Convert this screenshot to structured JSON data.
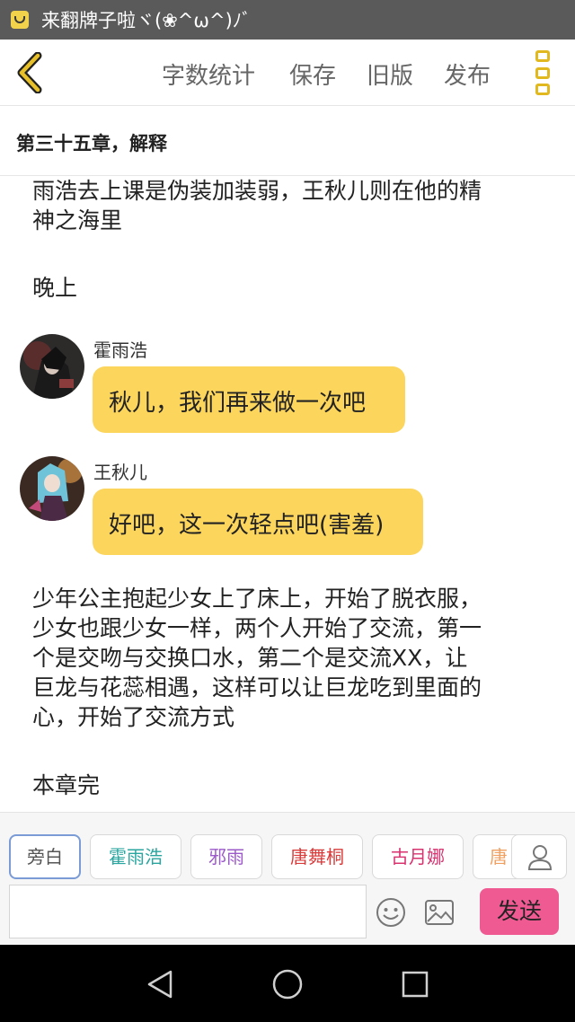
{
  "status_bar": {
    "title": "来翻牌子啦ヾ(❀^ω^)ﾉﾞ",
    "icon": "app-icon"
  },
  "toolbar": {
    "back_icon": "chevron-left-icon",
    "items": [
      "字数统计",
      "保存",
      "旧版",
      "发布"
    ],
    "menu_icon": "more-vertical-icon",
    "accent": "#e1b91f"
  },
  "chapter": {
    "title": "第三十五章，解释"
  },
  "content": {
    "para1_lines": [
      "雨浩去上课是伪装加装弱，王秋儿则在他的精",
      "神之海里"
    ],
    "para2": "晚上",
    "dialogues": [
      {
        "speaker": "霍雨浩",
        "text": "秋儿，我们再来做一次吧"
      },
      {
        "speaker": "王秋儿",
        "text": "好吧，这一次轻点吧(害羞)"
      }
    ],
    "para3_lines": [
      "少年公主抱起少女上了床上，开始了脱衣服，",
      "少女也跟少女一样，两个人开始了交流，第一",
      "个是交吻与交换口水，第二个是交流XX，让",
      "巨龙与花蕊相遇，这样可以让巨龙吃到里面的",
      "心，开始了交流方式"
    ],
    "para4": "本章完",
    "bubble_color": "#fcd55d"
  },
  "characters": {
    "chips": [
      {
        "label": "旁白",
        "color": "#555555"
      },
      {
        "label": "霍雨浩",
        "color": "#2aa6a0"
      },
      {
        "label": "邪雨",
        "color": "#9b59c9"
      },
      {
        "label": "唐舞桐",
        "color": "#d93a3a"
      },
      {
        "label": "古月娜",
        "color": "#d8336f"
      },
      {
        "label": "唐",
        "color": "#f0a060"
      }
    ],
    "person_icon": "person-icon"
  },
  "input": {
    "value": "",
    "placeholder": ""
  },
  "actions": {
    "emoji_icon": "smiley-icon",
    "image_icon": "image-icon",
    "send_label": "发送",
    "send_color": "#f05a93"
  },
  "nav": {
    "back_icon": "nav-back-icon",
    "home_icon": "nav-home-icon",
    "recent_icon": "nav-recent-icon"
  }
}
